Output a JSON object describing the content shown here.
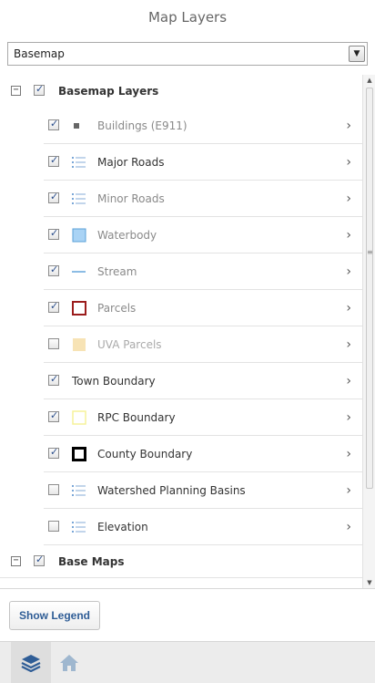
{
  "header": {
    "title": "Map Layers"
  },
  "selector": {
    "value": "Basemap",
    "arrow": "▼"
  },
  "groups": [
    {
      "label": "Basemap Layers",
      "expander": "−",
      "checked": true
    },
    {
      "label": "Base Maps",
      "expander": "−",
      "checked": true
    }
  ],
  "layers": [
    {
      "label": "Buildings (E911)",
      "checked": true,
      "symbol": "small-square-icon",
      "tone": "dim"
    },
    {
      "label": "Major Roads",
      "checked": true,
      "symbol": "list-icon",
      "tone": "active"
    },
    {
      "label": "Minor Roads",
      "checked": true,
      "symbol": "list-icon",
      "tone": "dim"
    },
    {
      "label": "Waterbody",
      "checked": true,
      "symbol": "blue-fill-square-icon",
      "tone": "dim"
    },
    {
      "label": "Stream",
      "checked": true,
      "symbol": "blue-line-icon",
      "tone": "dim"
    },
    {
      "label": "Parcels",
      "checked": true,
      "symbol": "red-outline-square-icon",
      "tone": "dim"
    },
    {
      "label": "UVA Parcels",
      "checked": false,
      "symbol": "tan-fill-square-icon",
      "tone": "faded"
    },
    {
      "label": "Town Boundary",
      "checked": true,
      "symbol": "",
      "tone": "active"
    },
    {
      "label": "RPC Boundary",
      "checked": true,
      "symbol": "yellow-outline-square-icon",
      "tone": "active"
    },
    {
      "label": "County Boundary",
      "checked": true,
      "symbol": "black-outline-square-icon",
      "tone": "active"
    },
    {
      "label": "Watershed Planning Basins",
      "checked": false,
      "symbol": "list-icon",
      "tone": "active"
    },
    {
      "label": "Elevation",
      "checked": false,
      "symbol": "list-icon",
      "tone": "active"
    }
  ],
  "chevron": "›",
  "footer": {
    "legend_button": "Show Legend"
  },
  "tabs": [
    {
      "icon": "layers-icon",
      "selected": true
    },
    {
      "icon": "home-icon",
      "selected": false
    }
  ],
  "colors": {
    "accent_blue": "#2f5d96",
    "water_fill": "#a9d3f5",
    "water_stroke": "#5aa0d8",
    "parcel_red": "#9b1c1c",
    "uva_tan": "#f7e3b5",
    "rpc_yellow": "#f6f29a"
  }
}
